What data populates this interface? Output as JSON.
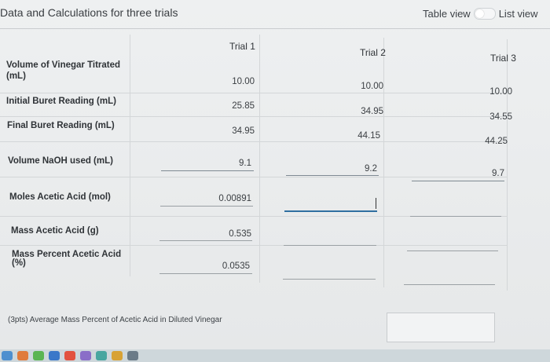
{
  "header": {
    "title": "Data and Calculations for three trials"
  },
  "view_toggle": {
    "table_label": "Table view",
    "list_label": "List view"
  },
  "columns": [
    "Trial 1",
    "Trial 2",
    "Trial 3"
  ],
  "rows": [
    {
      "label": "Volume of Vinegar Titrated\n(mL)",
      "values": [
        "10.00",
        "10.00",
        "10.00"
      ]
    },
    {
      "label": "Initial Buret Reading (mL)",
      "values": [
        "25.85",
        "34.95",
        "34.55"
      ]
    },
    {
      "label": "Final Buret Reading (mL)",
      "values": [
        "34.95",
        "44.15",
        "44.25"
      ]
    },
    {
      "label": "Volume NaOH used (mL)",
      "values": [
        "9.1",
        "9.2",
        "9.7"
      ]
    },
    {
      "label": "Moles Acetic Acid (mol)",
      "values": [
        "0.00891",
        "",
        ""
      ]
    },
    {
      "label": "Mass Acetic Acid (g)",
      "values": [
        "0.535",
        "",
        ""
      ]
    },
    {
      "label": "Mass Percent Acetic Acid\n(%)",
      "values": [
        "0.0535",
        "",
        ""
      ]
    }
  ],
  "footer": {
    "prompt": "(3pts)  Average Mass Percent of Acetic Acid in Diluted Vinegar",
    "answer": ""
  },
  "colors": {
    "accent": "#4a7fa8",
    "background": "#eceeef"
  },
  "taskbar_icons": [
    "finder-icon",
    "photos-icon",
    "messages-icon",
    "mail-icon",
    "calendar-icon",
    "app-icon",
    "app-icon",
    "app-icon",
    "app-icon"
  ]
}
